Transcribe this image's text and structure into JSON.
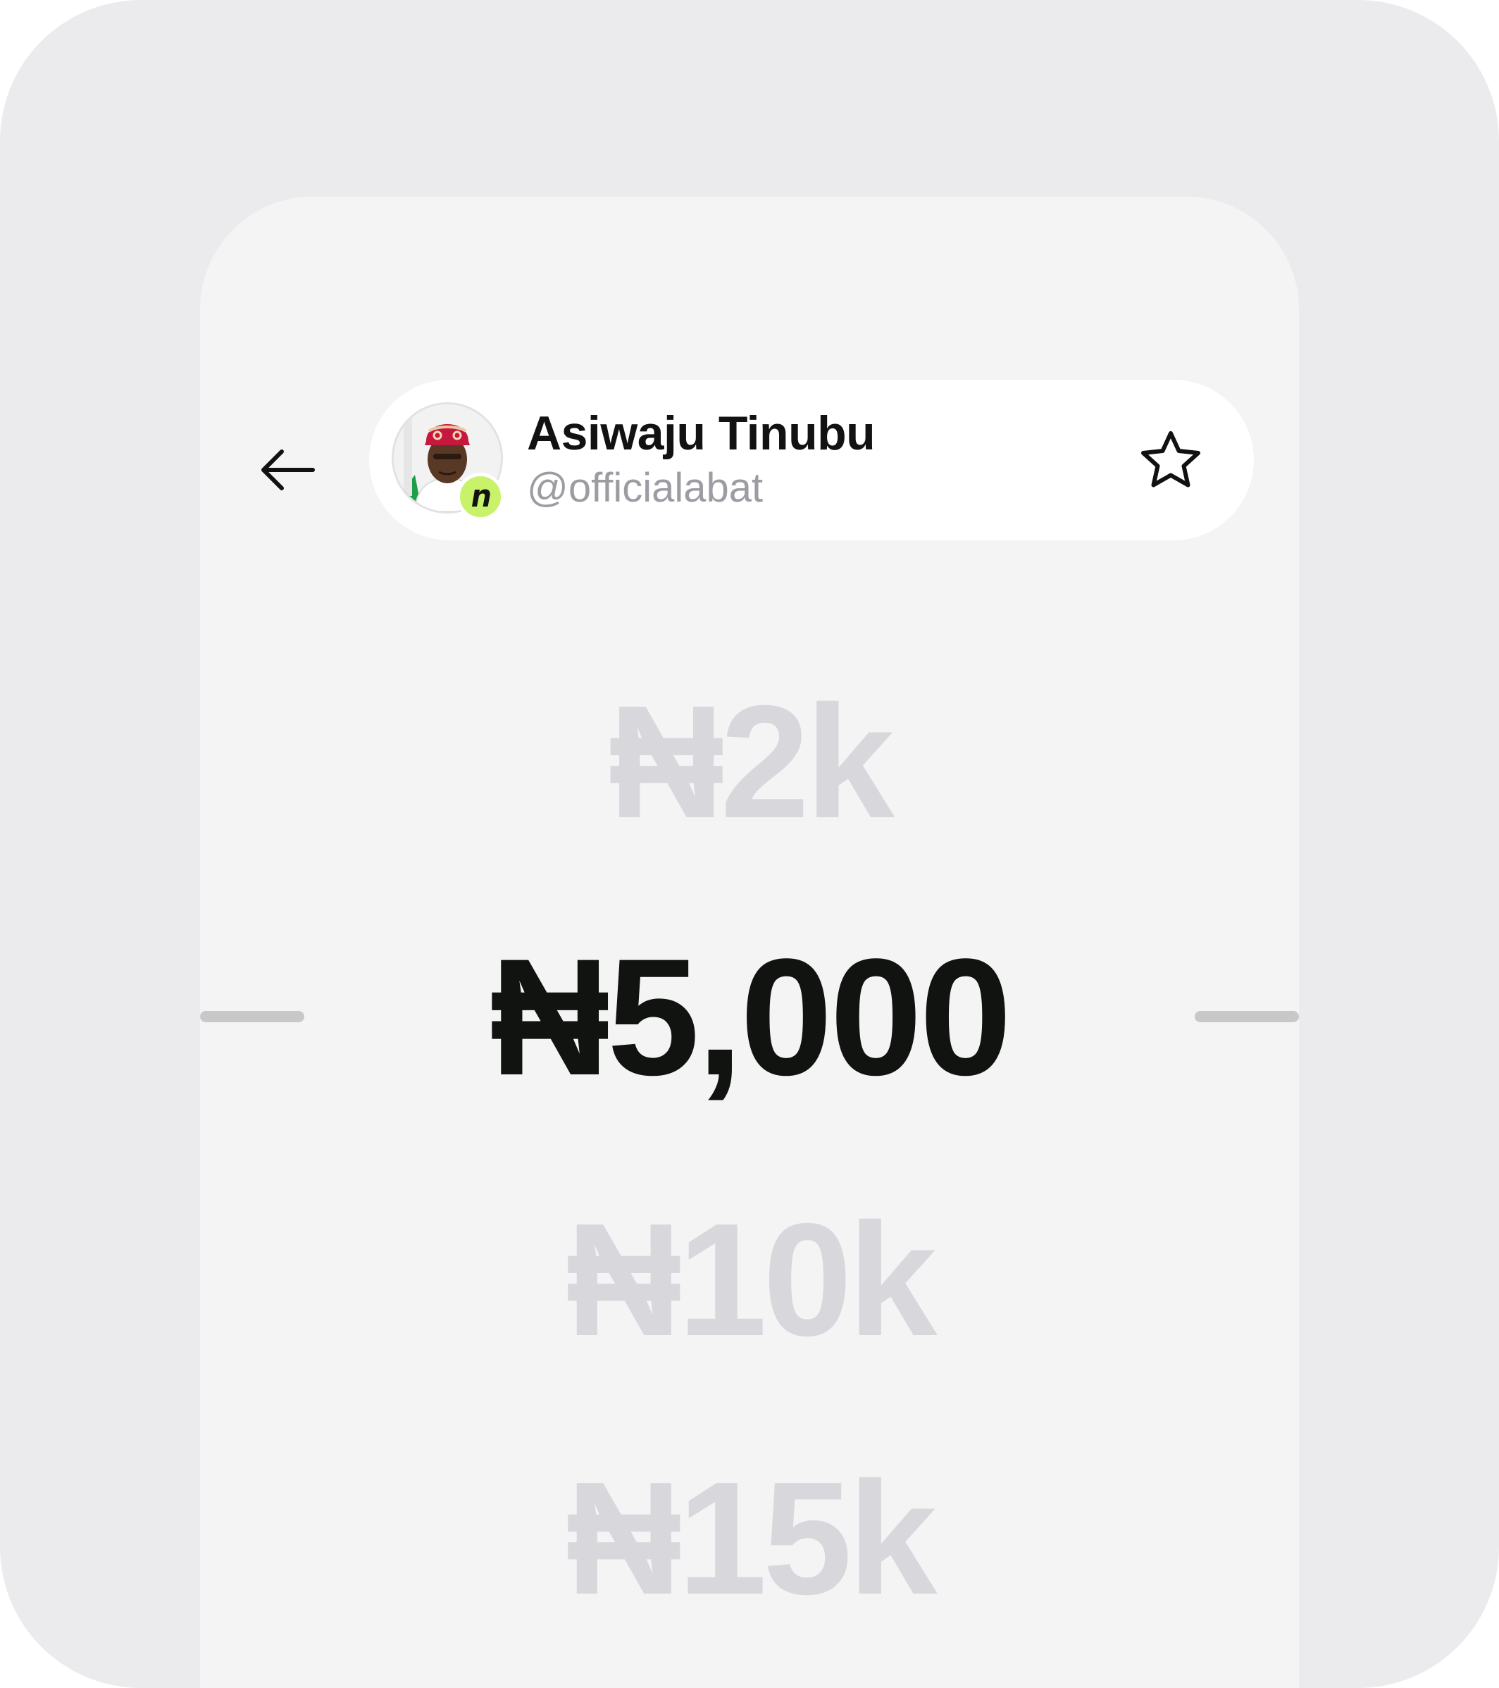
{
  "header": {
    "name": "Asiwaju Tinubu",
    "handle": "@officialabat",
    "back_icon": "arrow-left-icon",
    "favorite_icon": "star-outline-icon",
    "badge_icon": "n-logo-icon"
  },
  "amount_picker": {
    "currency": "₦",
    "options": [
      {
        "label": "₦2k",
        "selected": false
      },
      {
        "label": "₦5,000",
        "selected": true
      },
      {
        "label": "₦10k",
        "selected": false
      },
      {
        "label": "₦15k",
        "selected": false
      }
    ]
  },
  "colors": {
    "frame_bg": "#EBEBED",
    "screen_bg": "#F4F4F4",
    "selected_text": "#111311",
    "muted_text": "#D8D8DC",
    "handle_text": "#9C9CA3",
    "badge_green": "#C8F26A"
  }
}
